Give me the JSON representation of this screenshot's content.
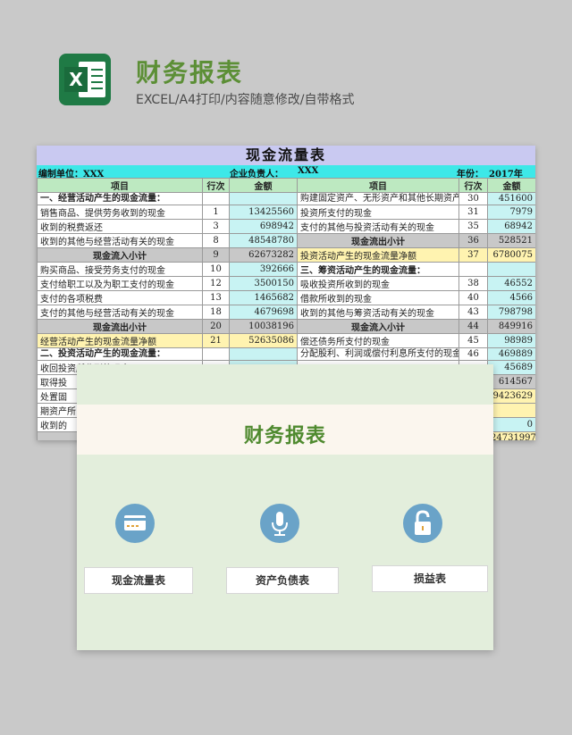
{
  "header": {
    "title": "财务报表",
    "subtitle": "EXCEL/A4打印/内容随意修改/自带格式",
    "logo_letter": "X"
  },
  "sheet": {
    "title": "现金流量表",
    "unit_label": "编制单位：XXX",
    "owner_label": "企业负责人：",
    "owner_value": "XXX",
    "year_label": "年份：",
    "year_value": "2017年",
    "columns": [
      "项目",
      "行次",
      "金额",
      "项目",
      "行次",
      "金额"
    ],
    "rows": [
      {
        "l": "一、经营活动产生的现金流量：",
        "ln": "",
        "la": "",
        "r": "购建固定资产、无形资产和其他长期资产所支付的现金",
        "rn": "30",
        "ra": "451600"
      },
      {
        "l": "销售商品、提供劳务收到的现金",
        "ln": "1",
        "la": "13425560",
        "r": "投资所支付的现金",
        "rn": "31",
        "ra": "7979"
      },
      {
        "l": "收到的税费返还",
        "ln": "3",
        "la": "698942",
        "r": "支付的其他与投资活动有关的现金",
        "rn": "35",
        "ra": "68942"
      },
      {
        "l": "收到的其他与经营活动有关的现金",
        "ln": "8",
        "la": "48548780",
        "r": "现金流出小计",
        "rn": "36",
        "ra": "528521"
      },
      {
        "l": "现金流入小计",
        "ln": "9",
        "la": "62673282",
        "r": "投资活动产生的现金流量净额",
        "rn": "37",
        "ra": "6780075"
      },
      {
        "l": "购买商品、接受劳务支付的现金",
        "ln": "10",
        "la": "392666",
        "r": "三、筹资活动产生的现金流量：",
        "rn": "",
        "ra": ""
      },
      {
        "l": "支付给职工以及为职工支付的现金",
        "ln": "12",
        "la": "3500150",
        "r": "吸收投资所收到的现金",
        "rn": "38",
        "ra": "46552"
      },
      {
        "l": "支付的各项税费",
        "ln": "13",
        "la": "1465682",
        "r": "借款所收到的现金",
        "rn": "40",
        "ra": "4566"
      },
      {
        "l": "支付的其他与经营活动有关的现金",
        "ln": "18",
        "la": "4679698",
        "r": "收到的其他与筹资活动有关的现金",
        "rn": "43",
        "ra": "798798"
      },
      {
        "l": "现金流出小计",
        "ln": "20",
        "la": "10038196",
        "r": "现金流入小计",
        "rn": "44",
        "ra": "849916"
      },
      {
        "l": "经营活动产生的现金流量净额",
        "ln": "21",
        "la": "52635086",
        "r": "偿还债务所支付的现金",
        "rn": "45",
        "ra": "98989"
      },
      {
        "l": "二、投资活动产生的现金流量：",
        "ln": "",
        "la": "",
        "r": "分配股利、利润或偿付利息所支付的现金",
        "rn": "46",
        "ra": "469889"
      },
      {
        "l": "收回投资所收到的现金",
        "ln": "",
        "la": "",
        "r": "",
        "rn": "",
        "ra": "45689"
      },
      {
        "l": "取得投",
        "ln": "",
        "la": "",
        "r": "",
        "rn": "",
        "ra": "614567"
      },
      {
        "l": "处置固",
        "ln": "",
        "la": "",
        "r": "",
        "rn": "",
        "ra": "9423629"
      },
      {
        "l": "期资产所",
        "ln": "",
        "la": "",
        "r": "",
        "rn": "",
        "ra": ""
      },
      {
        "l": "收到的",
        "ln": "",
        "la": "",
        "r": "",
        "rn": "",
        "ra": "0"
      },
      {
        "l": "",
        "ln": "",
        "la": "",
        "r": "",
        "rn": "",
        "ra": "24731997"
      }
    ]
  },
  "panel": {
    "title": "财务报表",
    "buttons": [
      "现金流量表",
      "资产负债表",
      "损益表"
    ],
    "icons": [
      "credit-card-icon",
      "microphone-icon",
      "unlock-icon"
    ]
  },
  "colors": {
    "brand_green": "#5c8f36",
    "excel_green": "#1f7a45",
    "icon_blue": "#6aa3c8",
    "panel_bg": "#e3eedc"
  }
}
